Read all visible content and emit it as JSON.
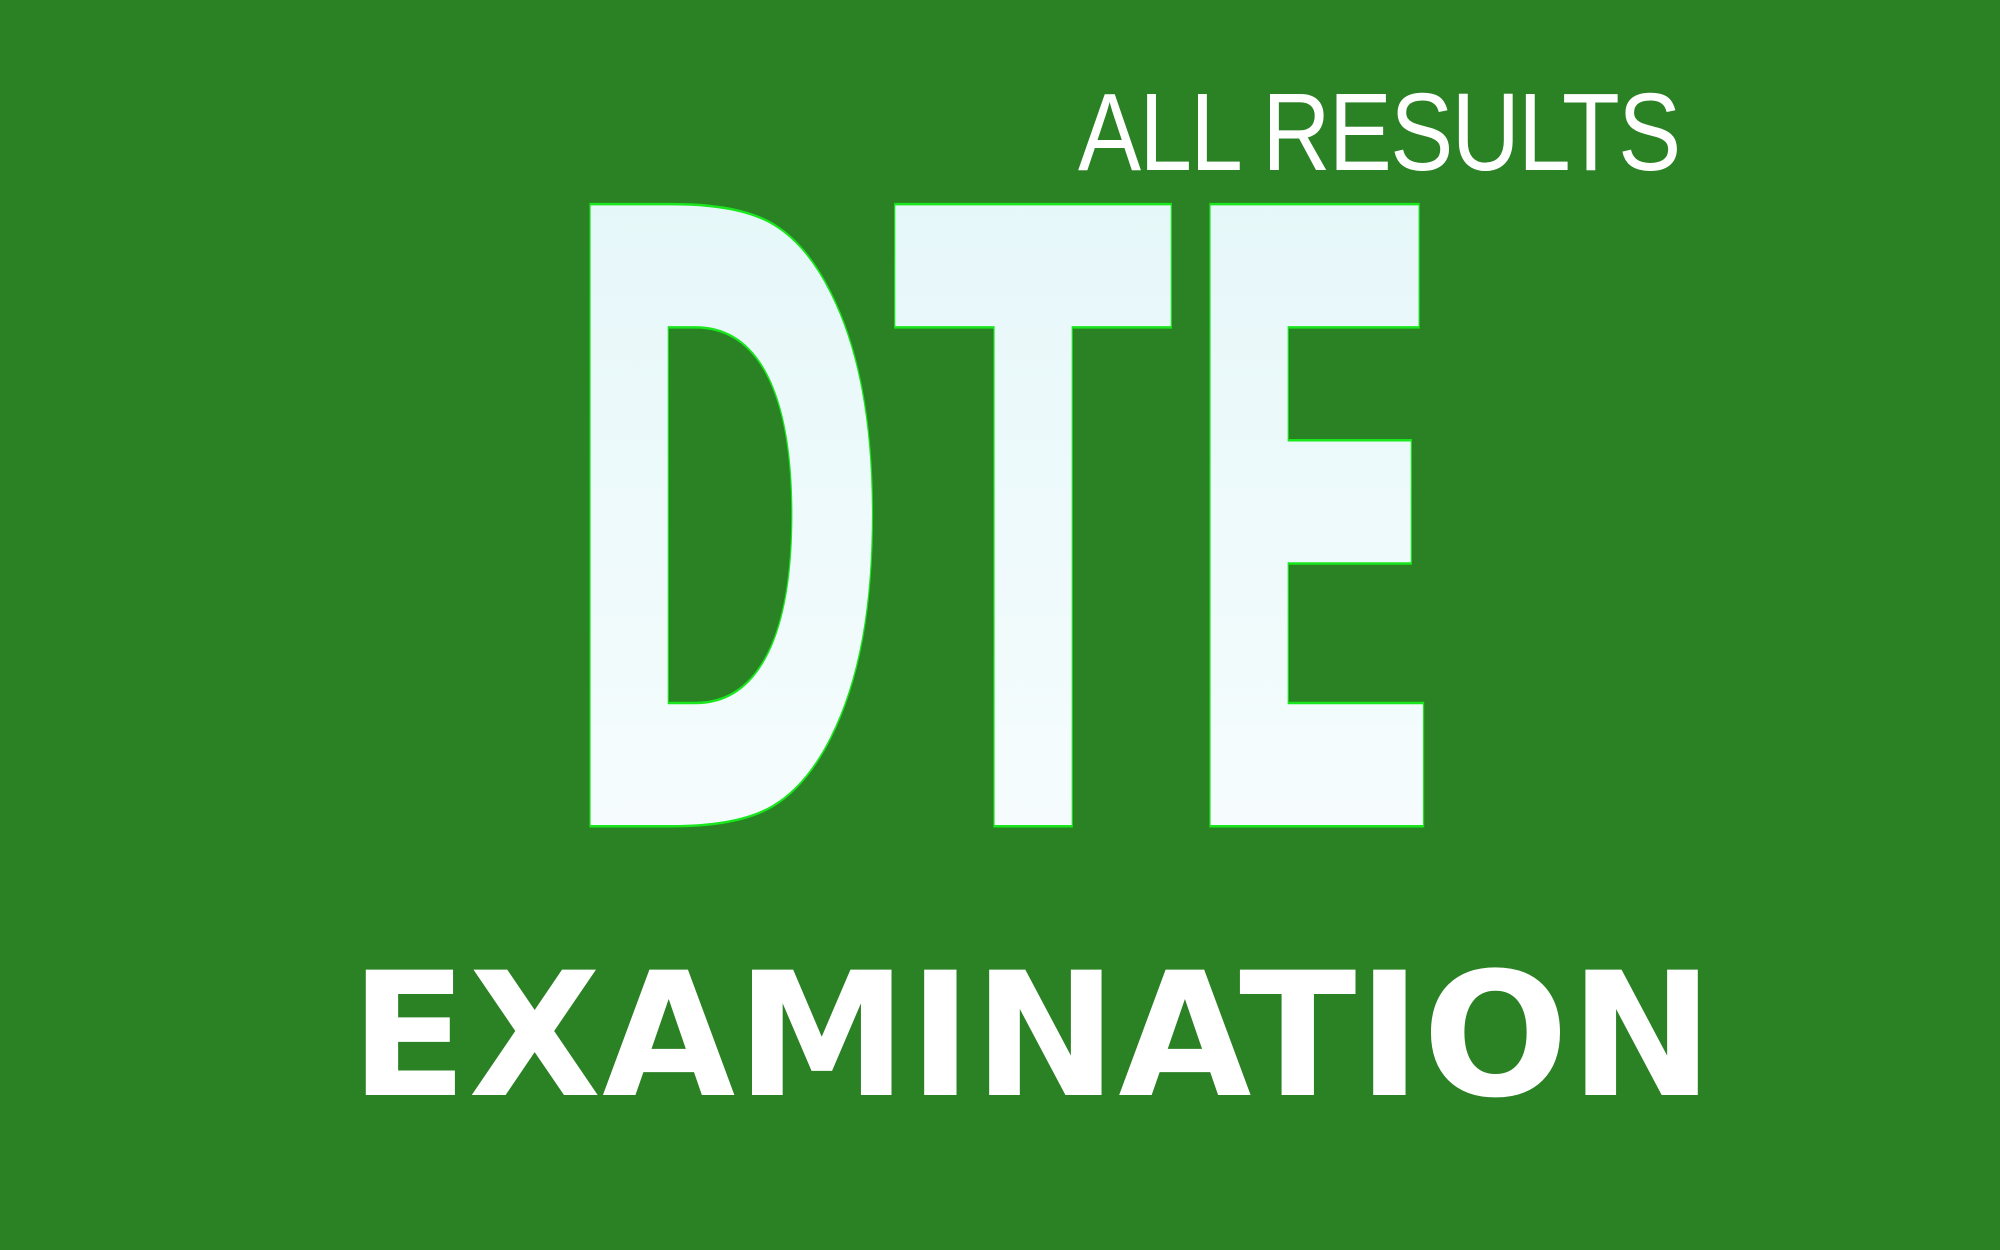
{
  "tagline": "ALL RESULTS",
  "logo_text": "DTE",
  "subtitle": "EXAMINATION",
  "colors": {
    "background": "#2b8224",
    "logo_fill_top": "#e2f6f8",
    "logo_fill_bottom": "#fbfeff",
    "logo_outline": "#19e61d",
    "text": "#ffffff"
  }
}
